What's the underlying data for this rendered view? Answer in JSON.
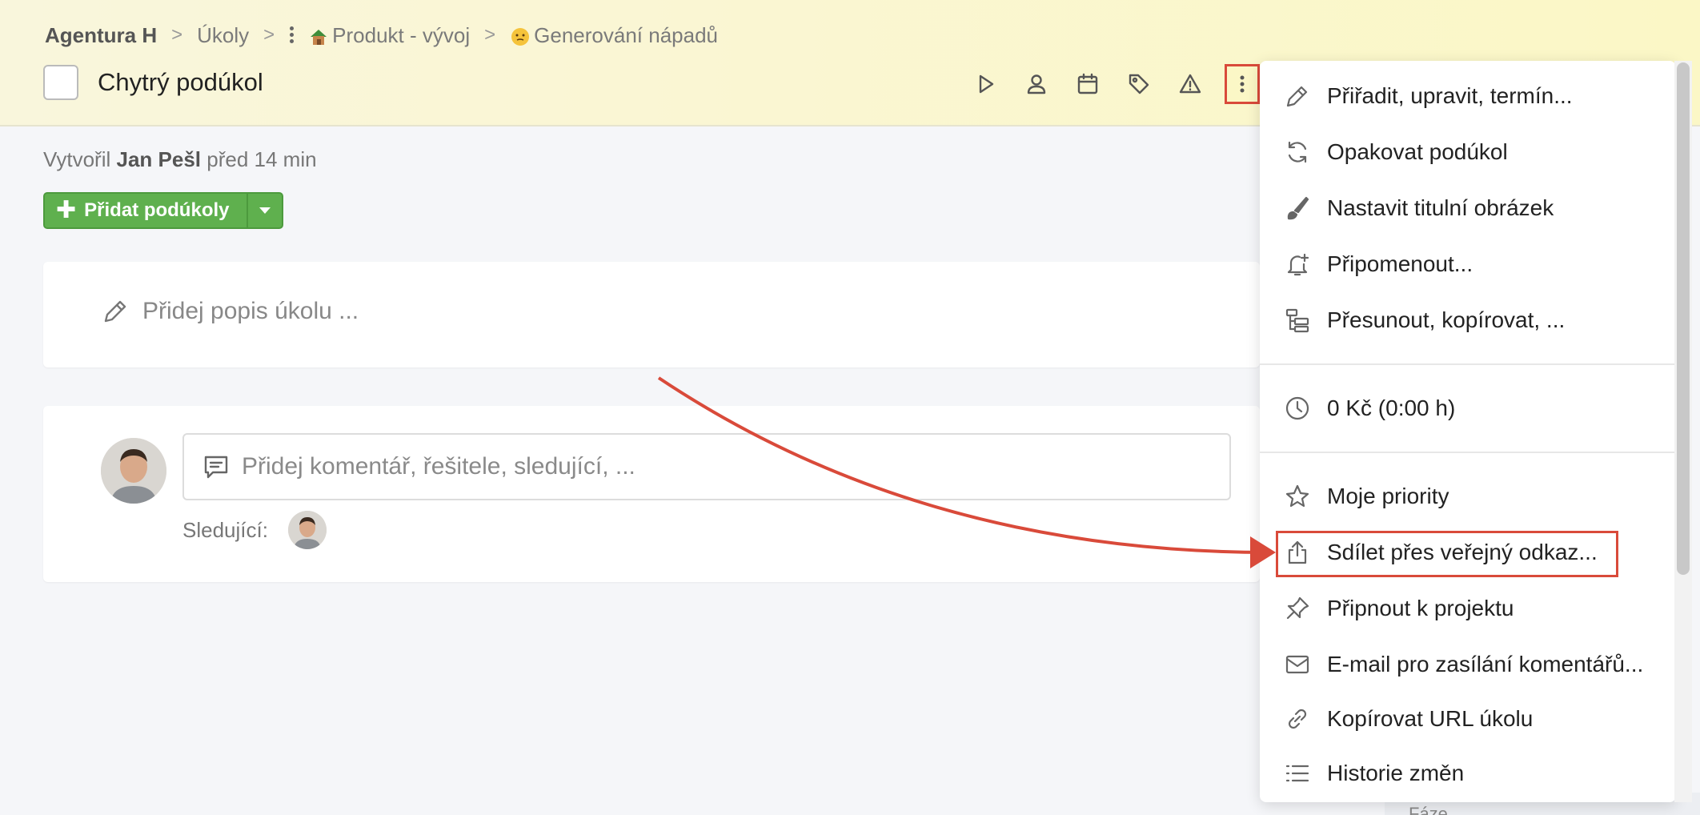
{
  "breadcrumb": {
    "items": [
      "Agentura H",
      "Úkoly",
      "Produkt - vývoj",
      "Generování nápadů"
    ]
  },
  "task": {
    "title": "Chytrý podúkol",
    "created_prefix": "Vytvořil",
    "created_by": "Jan Pešl",
    "created_when": "před 14 min"
  },
  "toolbar": {
    "icons": [
      "play-icon",
      "user-icon",
      "calendar-icon",
      "tag-icon",
      "warning-icon",
      "more-vertical-icon"
    ]
  },
  "actions": {
    "add_subtasks_label": "Přidat podúkoly"
  },
  "description": {
    "placeholder": "Přidej popis úkolu ..."
  },
  "comments": {
    "placeholder": "Přidej komentář, řešitele, sledující, ...",
    "followers_label": "Sledující:"
  },
  "menu": {
    "items": [
      {
        "label": "Přiřadit, upravit, termín...",
        "icon": "pencil-icon"
      },
      {
        "label": "Opakovat podúkol",
        "icon": "repeat-icon"
      },
      {
        "label": "Nastavit titulní obrázek",
        "icon": "brush-icon"
      },
      {
        "label": "Připomenout...",
        "icon": "bell-plus-icon"
      },
      {
        "label": "Přesunout, kopírovat, ...",
        "icon": "move-icon"
      },
      {
        "label": "0 Kč (0:00 h)",
        "icon": "clock-icon"
      },
      {
        "label": "Moje priority",
        "icon": "star-icon"
      },
      {
        "label": "Sdílet přes veřejný odkaz...",
        "icon": "share-icon"
      },
      {
        "label": "Připnout k projektu",
        "icon": "pin-icon"
      },
      {
        "label": "E-mail pro zasílání komentářů...",
        "icon": "mail-icon"
      },
      {
        "label": "Kopírovat URL úkolu",
        "icon": "link-icon"
      },
      {
        "label": "Historie změn",
        "icon": "list-icon"
      }
    ]
  },
  "right_panel": {
    "bottom_text": "Fáze"
  },
  "colors": {
    "header_bg": "#fbf7c6",
    "accent_green": "#5fb04e",
    "highlight_red": "#d94a3a"
  }
}
